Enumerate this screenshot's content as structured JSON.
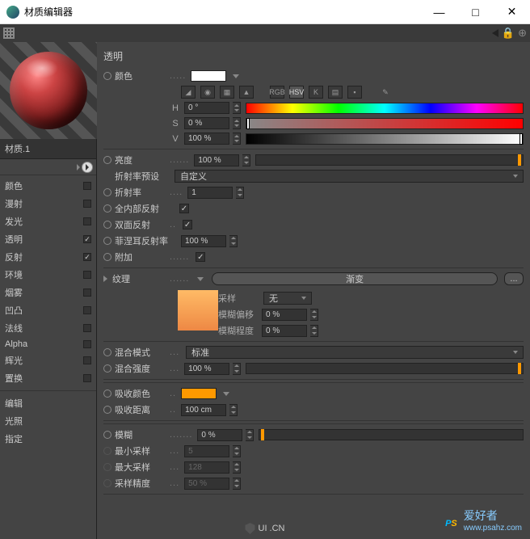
{
  "window": {
    "title": "材质编辑器"
  },
  "material_name": "材质.1",
  "channels": [
    {
      "label": "颜色",
      "checked": false,
      "active": false
    },
    {
      "label": "漫射",
      "checked": false,
      "active": false
    },
    {
      "label": "发光",
      "checked": false,
      "active": false
    },
    {
      "label": "透明",
      "checked": true,
      "active": true
    },
    {
      "label": "反射",
      "checked": true,
      "active": false
    },
    {
      "label": "环境",
      "checked": false,
      "active": false
    },
    {
      "label": "烟雾",
      "checked": false,
      "active": false
    },
    {
      "label": "凹凸",
      "checked": false,
      "active": false
    },
    {
      "label": "法线",
      "checked": false,
      "active": false
    },
    {
      "label": "Alpha",
      "checked": false,
      "active": false
    },
    {
      "label": "辉光",
      "checked": false,
      "active": false
    },
    {
      "label": "置换",
      "checked": false,
      "active": false
    }
  ],
  "channels2": [
    {
      "label": "编辑",
      "active": true
    },
    {
      "label": "光照",
      "active": false
    },
    {
      "label": "指定",
      "active": false
    }
  ],
  "panel": {
    "title": "透明",
    "color_label": "颜色",
    "hsv": {
      "h_label": "H",
      "h_val": "0 °",
      "s_label": "S",
      "s_val": "0 %",
      "v_label": "V",
      "v_val": "100 %"
    },
    "brightness": {
      "label": "亮度",
      "value": "100 %"
    },
    "refraction_preset": {
      "label": "折射率预设",
      "value": "自定义"
    },
    "refraction": {
      "label": "折射率",
      "value": "1"
    },
    "total_internal": {
      "label": "全内部反射",
      "checked": true
    },
    "double_sided": {
      "label": "双面反射",
      "checked": true
    },
    "fresnel": {
      "label": "菲涅耳反射率",
      "value": "100 %"
    },
    "additive": {
      "label": "附加",
      "checked": true
    },
    "texture": {
      "label": "纹理",
      "button": "渐变"
    },
    "sampling": {
      "label": "采样",
      "value": "无"
    },
    "blur_offset": {
      "label": "模糊偏移",
      "value": "0 %"
    },
    "blur_scale": {
      "label": "模糊程度",
      "value": "0 %"
    },
    "blend_mode": {
      "label": "混合模式",
      "value": "标准"
    },
    "blend_strength": {
      "label": "混合强度",
      "value": "100 %"
    },
    "absorb_color": {
      "label": "吸收颜色"
    },
    "absorb_dist": {
      "label": "吸收距离",
      "value": "100 cm"
    },
    "blur": {
      "label": "模糊",
      "value": "0 %"
    },
    "min_samples": {
      "label": "最小采样",
      "value": "5"
    },
    "max_samples": {
      "label": "最大采样",
      "value": "128"
    },
    "sample_acc": {
      "label": "采样精度",
      "value": "50 %"
    }
  },
  "watermark": {
    "brand": "爱好者",
    "url": "www.psahz.com"
  },
  "footer": "UI .CN"
}
